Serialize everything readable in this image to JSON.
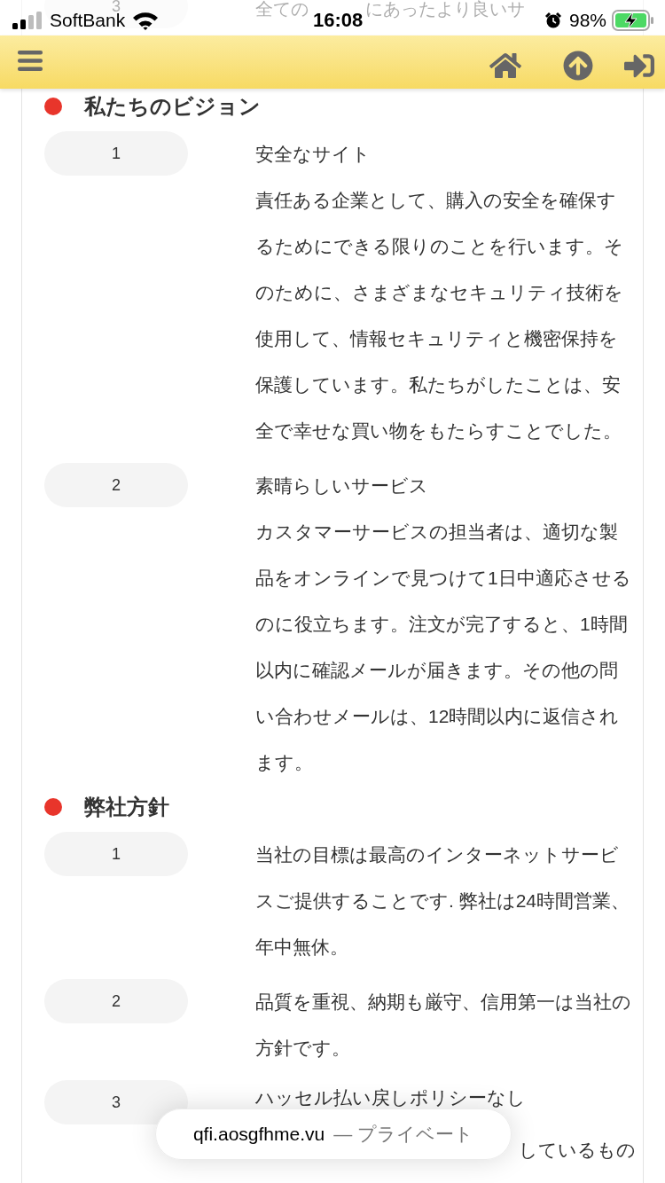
{
  "status_bar": {
    "carrier": "SoftBank",
    "time": "16:08",
    "battery": "98%"
  },
  "partial_row": {
    "number": "3",
    "fragments": [
      "全ての",
      "にあったより良いサ"
    ]
  },
  "sections": [
    {
      "title": "私たちのビジョン",
      "items": [
        {
          "number": "1",
          "title": "安全なサイト",
          "body": "責任ある企業として、購入の安全を確保するためにできる限りのことを行います。そのために、さまざまなセキュリティ技術を使用して、情報セキュリティと機密保持を保護しています。私たちがしたことは、安全で幸せな買い物をもたらすことでした。"
        },
        {
          "number": "2",
          "title": "素晴らしいサービス",
          "body": "カスタマーサービスの担当者は、適切な製品をオンラインで見つけて1日中適応させるのに役立ちます。注文が完了すると、1時間以内に確認メールが届きます。その他の問い合わせメールは、12時間以内に返信されます。"
        }
      ]
    },
    {
      "title": "弊社方針",
      "items": [
        {
          "number": "1",
          "body": "当社の目標は最高のインターネットサービスご提供することです. 弊社は24時間営業、年中無休。"
        },
        {
          "number": "2",
          "body": "品質を重視、納期も厳守、信用第一は当社の方針です。"
        },
        {
          "number": "3",
          "body": "ハッセル払い戻しポリシーなし",
          "continuation": "しているもの"
        }
      ]
    }
  ],
  "url_bar": {
    "domain": "qfi.aosgfhme.vu",
    "label": "— プライベート"
  }
}
